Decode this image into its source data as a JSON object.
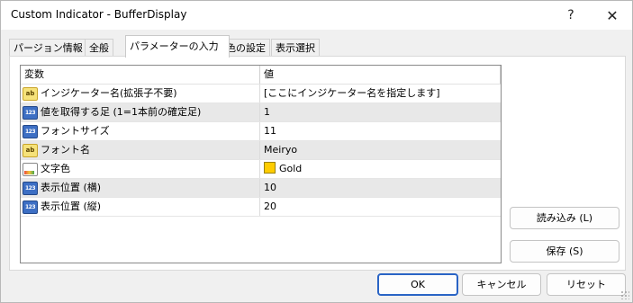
{
  "window": {
    "title": "Custom Indicator - BufferDisplay",
    "help_glyph": "?",
    "close_glyph": "✕"
  },
  "tabs": [
    {
      "label": "パージョン情報",
      "active": false
    },
    {
      "label": "全般",
      "active": false
    },
    {
      "label": "パラメーターの入力",
      "active": true
    },
    {
      "label": "色の設定",
      "active": false
    },
    {
      "label": "表示選択",
      "active": false
    }
  ],
  "grid": {
    "col_variable": "変数",
    "col_value": "値",
    "rows": [
      {
        "icon": "text-param-icon",
        "name": "インジケーター名(拡張子不要)",
        "value": "[ここにインジケーター名を指定します]"
      },
      {
        "icon": "number-param-icon",
        "name": "値を取得する足 (1=1本前の確定足)",
        "value": "1"
      },
      {
        "icon": "number-param-icon",
        "name": "フォントサイズ",
        "value": "11"
      },
      {
        "icon": "text-param-icon",
        "name": "フォント名",
        "value": "Meiryo"
      },
      {
        "icon": "color-param-icon",
        "name": "文字色",
        "value": "Gold",
        "swatch": "#ffcc00"
      },
      {
        "icon": "number-param-icon",
        "name": "表示位置 (横)",
        "value": "10"
      },
      {
        "icon": "number-param-icon",
        "name": "表示位置 (縦)",
        "value": "20"
      }
    ],
    "icon_text": {
      "ab": "ab",
      "num": "123"
    }
  },
  "buttons": {
    "load": "読み込み (L)",
    "save": "保存 (S)",
    "ok": "OK",
    "cancel": "キャンセル",
    "reset": "リセット"
  },
  "colors": {
    "accent": "#2a64c5",
    "gold": "#ffcc00"
  }
}
